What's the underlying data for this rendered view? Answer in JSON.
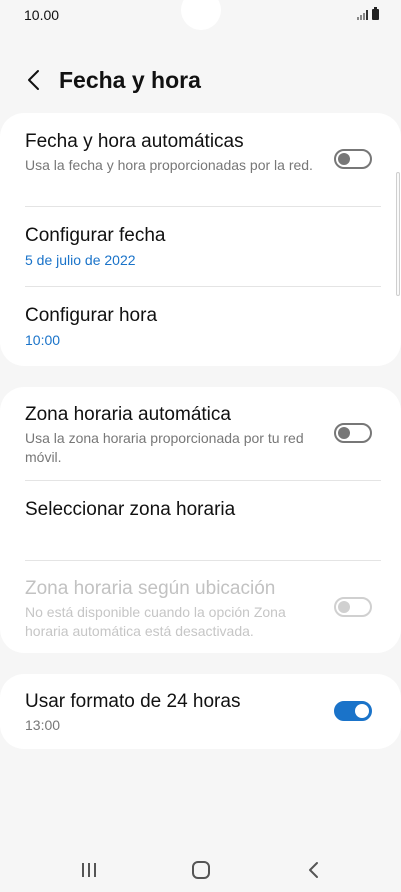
{
  "status_bar": {
    "time": "10.00"
  },
  "header": {
    "title": "Fecha y hora"
  },
  "section_date_time": {
    "auto": {
      "title": "Fecha y hora automáticas",
      "subtitle": "Usa la fecha y hora proporcionadas por la red.",
      "enabled": false
    },
    "set_date": {
      "title": "Configurar fecha",
      "value": "5 de julio de 2022"
    },
    "set_time": {
      "title": "Configurar hora",
      "value": "10:00"
    }
  },
  "section_timezone": {
    "auto": {
      "title": "Zona horaria automática",
      "subtitle": "Usa la zona horaria proporcionada por tu red móvil.",
      "enabled": false
    },
    "select": {
      "title": "Seleccionar zona horaria"
    },
    "location": {
      "title": "Zona horaria según ubicación",
      "subtitle": "No está disponible cuando la opción Zona horaria automática está desactivada.",
      "enabled": false,
      "disabled": true
    }
  },
  "section_format": {
    "use_24h": {
      "title": "Usar formato de 24 horas",
      "value": "13:00",
      "enabled": true
    }
  },
  "colors": {
    "accent": "#1a73c9",
    "background": "#f6f6f6",
    "card": "#ffffff"
  },
  "icons": {
    "back": "chevron-left-icon",
    "recents": "recents-icon",
    "home": "home-icon",
    "nav_back": "nav-back-icon"
  }
}
